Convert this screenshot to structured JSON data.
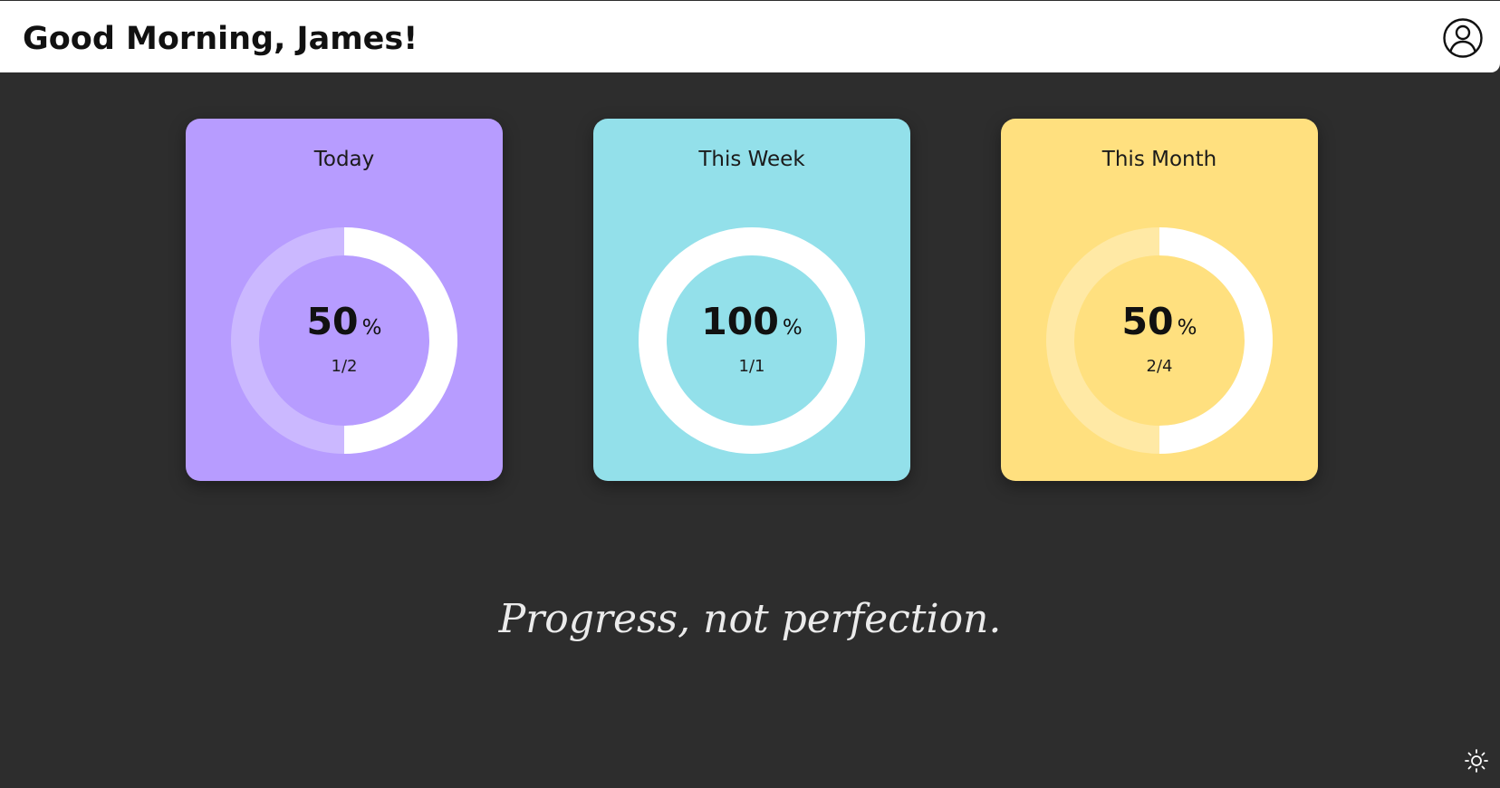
{
  "header": {
    "greeting": "Good Morning, James!",
    "profile_icon": "user-circle-icon"
  },
  "cards": [
    {
      "id": "today",
      "title": "Today",
      "percent": 50,
      "percent_label": "50",
      "percent_sign": "%",
      "fraction": "1/2",
      "progress": 0.5,
      "color": "#b79cff",
      "track_color": "#cbb8ff",
      "fill_color": "#ffffff"
    },
    {
      "id": "week",
      "title": "This Week",
      "percent": 100,
      "percent_label": "100",
      "percent_sign": "%",
      "fraction": "1/1",
      "progress": 1.0,
      "color": "#93e0ea",
      "track_color": "#b4eaf1",
      "fill_color": "#ffffff"
    },
    {
      "id": "month",
      "title": "This Month",
      "percent": 50,
      "percent_label": "50",
      "percent_sign": "%",
      "fraction": "2/4",
      "progress": 0.5,
      "color": "#ffe07f",
      "track_color": "#ffe9a5",
      "fill_color": "#ffffff"
    }
  ],
  "quote": "Progress, not perfection.",
  "theme_toggle_icon": "sun-icon",
  "colors": {
    "background": "#2d2d2d",
    "header_background": "#ffffff",
    "quote_text": "#ebebeb"
  }
}
